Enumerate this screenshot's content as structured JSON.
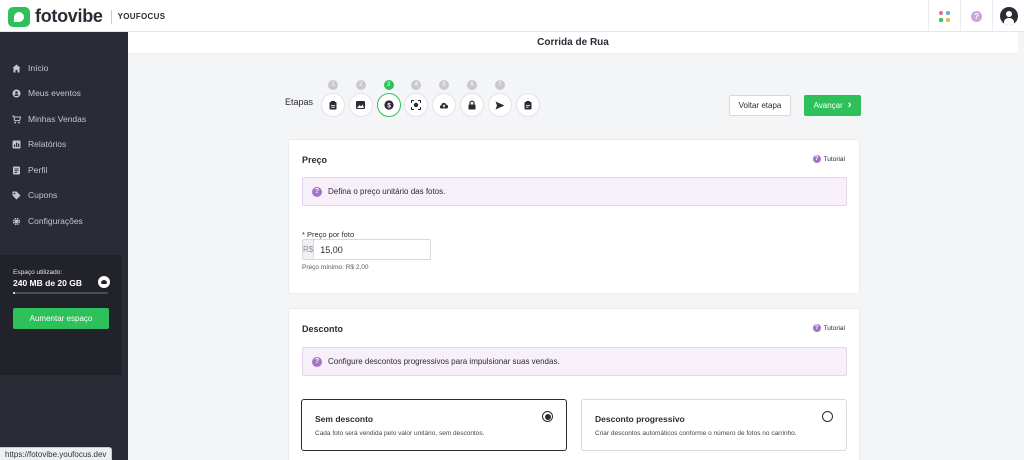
{
  "brand": {
    "name": "fotovibe",
    "sub": "YOUFOCUS",
    "accent": "#2ec05a"
  },
  "topbar": {
    "icons": [
      "apps-icon",
      "help-icon",
      "user-icon"
    ]
  },
  "sidebar": {
    "items": [
      {
        "label": "Início",
        "icon": "home-icon"
      },
      {
        "label": "Meus eventos",
        "icon": "events-icon"
      },
      {
        "label": "Minhas Vendas",
        "icon": "cart-icon"
      },
      {
        "label": "Relatórios",
        "icon": "report-icon"
      },
      {
        "label": "Perfil",
        "icon": "profile-icon"
      },
      {
        "label": "Cupons",
        "icon": "tag-icon"
      },
      {
        "label": "Configurações",
        "icon": "gear-icon"
      }
    ],
    "storage": {
      "label": "Espaço utilizado:",
      "value": "240 MB de 20 GB",
      "used_fraction": 0.012,
      "button": "Aumentar espaço"
    }
  },
  "page": {
    "title": "Corrida de Rua"
  },
  "stepper": {
    "label": "Etapas",
    "active_index": 2,
    "steps": [
      {
        "num": "1",
        "icon": "clipboard-icon"
      },
      {
        "num": "2",
        "icon": "image-icon"
      },
      {
        "num": "3",
        "icon": "price-icon"
      },
      {
        "num": "4",
        "icon": "face-scan-icon"
      },
      {
        "num": "5",
        "icon": "upload-cloud-icon"
      },
      {
        "num": "6",
        "icon": "lock-icon"
      },
      {
        "num": "7",
        "icon": "send-icon"
      },
      {
        "num": "",
        "icon": "checklist-icon"
      }
    ]
  },
  "actions": {
    "back": "Voltar etapa",
    "next": "Avançar"
  },
  "price_card": {
    "title": "Preço",
    "tutorial": "Tutorial",
    "info": "Defina o preço unitário das fotos.",
    "field_label": "* Preço por foto",
    "prefix": "R$",
    "value": "15,00",
    "hint": "Preço mínimo: R$ 2,00"
  },
  "discount_card": {
    "title": "Desconto",
    "tutorial": "Tutorial",
    "info": "Configure descontos progressivos para impulsionar suas vendas.",
    "options": [
      {
        "title": "Sem desconto",
        "desc": "Cada foto será vendida pelo valor unitário, sem descontos.",
        "selected": true
      },
      {
        "title": "Desconto progressivo",
        "desc": "Criar descontos automáticos conforme o número de fotos no carrinho.",
        "selected": false
      }
    ]
  },
  "status_bar": {
    "url": "https://fotovibe.youfocus.dev"
  }
}
